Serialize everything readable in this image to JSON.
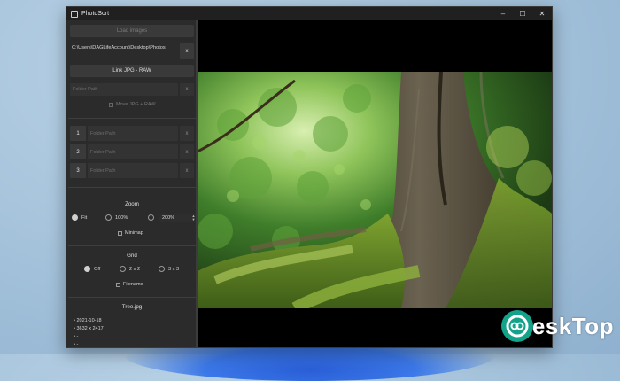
{
  "window": {
    "title": "PhotoSort",
    "controls": {
      "minimize": "–",
      "maximize": "☐",
      "close": "✕"
    }
  },
  "sidebar": {
    "load_images_label": "Load images",
    "current_path": "C:\\Users\\DAGLifeAccount\\Desktop\\Photos",
    "clear_path_label": "x",
    "link_button_label": "Link JPG - RAW",
    "link_field_placeholder": "Folder Path",
    "link_clear_label": "x",
    "move_checkbox_label": "Move JPG + RAW",
    "slots": [
      {
        "number": "1",
        "placeholder": "Folder Path",
        "clear_label": "x"
      },
      {
        "number": "2",
        "placeholder": "Folder Path",
        "clear_label": "x"
      },
      {
        "number": "3",
        "placeholder": "Folder Path",
        "clear_label": "x"
      }
    ],
    "zoom": {
      "title": "Zoom",
      "options": [
        "Fit",
        "100%",
        ""
      ],
      "selected": "Fit",
      "custom_value": "200%",
      "minimap_label": "Minimap"
    },
    "grid": {
      "title": "Grid",
      "options": [
        "Off",
        "2 x 2",
        "3 x 3"
      ],
      "selected": "Off",
      "filename_label": "Filename"
    },
    "file_info": {
      "filename": "Tree.jpg",
      "lines": [
        "• 2021-10-18",
        "• 3632 x 2417",
        "• -",
        "• -"
      ]
    }
  },
  "viewer": {
    "image_subject": "tree-trunk-with-moss-photo"
  },
  "watermark": {
    "text": "eskTop",
    "color": "#13a38a"
  }
}
